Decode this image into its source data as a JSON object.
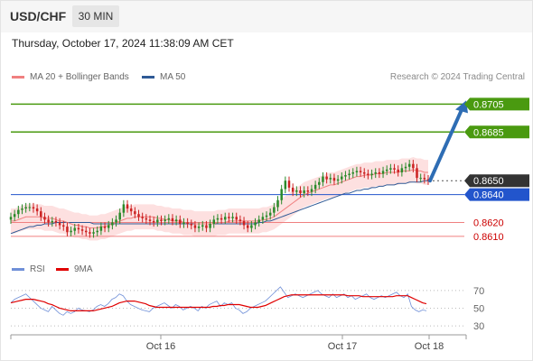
{
  "header": {
    "symbol": "USD/CHF",
    "timeframe": "30 MIN",
    "datetime": "Thursday, October 17, 2024 11:38:09 AM CET"
  },
  "legend": {
    "ma20_label": "MA 20 + Bollinger Bands",
    "ma50_label": "MA 50",
    "ma20_color": "#f08080",
    "ma50_color": "#2f5a96",
    "credit": "Research © 2024 Trading Central"
  },
  "rsi_legend": {
    "rsi_label": "RSI",
    "ma_label": "9MA",
    "rsi_color": "#7090d8",
    "ma_color": "#e00000"
  },
  "colors": {
    "up_candle": "#2a8a2a",
    "down_candle": "#cc2222",
    "target_line": "#4a9a10",
    "current_label": "#333333",
    "pivot_line": "#2255cc",
    "support_line": "#f08080",
    "support_text": "#cc0000",
    "arrow": "#2e6db4",
    "band_fill": "#fde0e0"
  },
  "chart_data": [
    {
      "type": "candlestick",
      "title": "USD/CHF 30 MIN",
      "ylim": [
        0.8595,
        0.8715
      ],
      "x_ticks": [
        "Oct 16",
        "Oct 17",
        "Oct 18"
      ],
      "levels": [
        {
          "value": 0.8705,
          "label": "0.8705",
          "kind": "target"
        },
        {
          "value": 0.8685,
          "label": "0.8685",
          "kind": "target"
        },
        {
          "value": 0.865,
          "label": "0.8650",
          "kind": "current"
        },
        {
          "value": 0.864,
          "label": "0.8640",
          "kind": "pivot"
        },
        {
          "value": 0.862,
          "label": "0.8620",
          "kind": "support"
        },
        {
          "value": 0.861,
          "label": "0.8610",
          "kind": "support"
        }
      ],
      "arrow": {
        "from": 0.865,
        "to": 0.8705
      },
      "close": [
        0.8624,
        0.8626,
        0.8629,
        0.863,
        0.8631,
        0.8631,
        0.863,
        0.8628,
        0.8624,
        0.8622,
        0.862,
        0.8621,
        0.862,
        0.8618,
        0.8617,
        0.8613,
        0.8614,
        0.8616,
        0.8615,
        0.8614,
        0.8613,
        0.8612,
        0.8613,
        0.8614,
        0.8617,
        0.8616,
        0.8618,
        0.862,
        0.8622,
        0.8627,
        0.8633,
        0.863,
        0.8628,
        0.8626,
        0.8624,
        0.8623,
        0.8622,
        0.8621,
        0.862,
        0.8622,
        0.8621,
        0.8622,
        0.8623,
        0.8621,
        0.8622,
        0.8619,
        0.862,
        0.8619,
        0.8618,
        0.8616,
        0.8617,
        0.8618,
        0.8616,
        0.8619,
        0.8622,
        0.8623,
        0.8622,
        0.8624,
        0.8623,
        0.8624,
        0.8622,
        0.8621,
        0.8618,
        0.8616,
        0.8618,
        0.862,
        0.8622,
        0.8624,
        0.8625,
        0.8627,
        0.8631,
        0.8636,
        0.8644,
        0.865,
        0.8645,
        0.8642,
        0.8643,
        0.8641,
        0.8643,
        0.8642,
        0.8644,
        0.8647,
        0.8649,
        0.8653,
        0.8651,
        0.8652,
        0.865,
        0.8651,
        0.8653,
        0.8654,
        0.8655,
        0.8656,
        0.8657,
        0.8656,
        0.8655,
        0.8654,
        0.8655,
        0.8656,
        0.8655,
        0.8657,
        0.8658,
        0.8659,
        0.8658,
        0.8656,
        0.8659,
        0.866,
        0.8662,
        0.8659,
        0.8652,
        0.8652,
        0.8651,
        0.865
      ],
      "ma20": [
        0.8621,
        0.8621,
        0.8622,
        0.8623,
        0.8624,
        0.8624,
        0.8624,
        0.8624,
        0.8624,
        0.8623,
        0.8623,
        0.8623,
        0.8622,
        0.8621,
        0.8621,
        0.862,
        0.8619,
        0.8618,
        0.8618,
        0.8617,
        0.8617,
        0.8616,
        0.8616,
        0.8616,
        0.8617,
        0.8617,
        0.8618,
        0.8619,
        0.862,
        0.8621,
        0.8622,
        0.8623,
        0.8623,
        0.8624,
        0.8624,
        0.8624,
        0.8624,
        0.8624,
        0.8624,
        0.8623,
        0.8623,
        0.8622,
        0.8622,
        0.8621,
        0.8621,
        0.8621,
        0.862,
        0.862,
        0.862,
        0.8619,
        0.8619,
        0.8619,
        0.8619,
        0.8619,
        0.8619,
        0.862,
        0.862,
        0.862,
        0.8621,
        0.8621,
        0.8621,
        0.8621,
        0.8621,
        0.8621,
        0.8621,
        0.8621,
        0.8621,
        0.8622,
        0.8622,
        0.8623,
        0.8624,
        0.8626,
        0.8628,
        0.863,
        0.8632,
        0.8634,
        0.8636,
        0.8638,
        0.864,
        0.8641,
        0.8642,
        0.8643,
        0.8644,
        0.8645,
        0.8646,
        0.8647,
        0.8647,
        0.8648,
        0.8649,
        0.865,
        0.8651,
        0.8652,
        0.8653,
        0.8653,
        0.8654,
        0.8654,
        0.8654,
        0.8655,
        0.8655,
        0.8655,
        0.8656,
        0.8656,
        0.8656,
        0.8656,
        0.8657,
        0.8657,
        0.8657,
        0.8658,
        0.8657,
        0.8657,
        0.8656,
        0.8656
      ],
      "ma50": [
        0.8612,
        0.8613,
        0.8614,
        0.8615,
        0.8616,
        0.8617,
        0.8617,
        0.8618,
        0.8618,
        0.8619,
        0.8619,
        0.8619,
        0.862,
        0.862,
        0.862,
        0.862,
        0.862,
        0.862,
        0.862,
        0.862,
        0.862,
        0.862,
        0.8619,
        0.8619,
        0.8619,
        0.8619,
        0.8619,
        0.8619,
        0.8619,
        0.8619,
        0.8619,
        0.8619,
        0.8619,
        0.8619,
        0.8619,
        0.8619,
        0.8619,
        0.8619,
        0.8619,
        0.8619,
        0.8619,
        0.8619,
        0.8619,
        0.8619,
        0.8619,
        0.8619,
        0.8619,
        0.8619,
        0.8619,
        0.8619,
        0.8619,
        0.8619,
        0.8619,
        0.8619,
        0.8619,
        0.8619,
        0.8619,
        0.8619,
        0.8619,
        0.8619,
        0.8619,
        0.8619,
        0.8619,
        0.8619,
        0.8619,
        0.8619,
        0.862,
        0.862,
        0.8621,
        0.8621,
        0.8622,
        0.8623,
        0.8624,
        0.8625,
        0.8626,
        0.8627,
        0.8628,
        0.8629,
        0.863,
        0.8631,
        0.8632,
        0.8633,
        0.8634,
        0.8635,
        0.8636,
        0.8637,
        0.8638,
        0.8639,
        0.864,
        0.8641,
        0.8641,
        0.8642,
        0.8643,
        0.8643,
        0.8644,
        0.8644,
        0.8645,
        0.8645,
        0.8646,
        0.8646,
        0.8647,
        0.8647,
        0.8647,
        0.8648,
        0.8648,
        0.8648,
        0.8649,
        0.8649,
        0.8649,
        0.8649,
        0.865,
        0.865
      ],
      "bb_width": 0.0009
    },
    {
      "type": "line",
      "title": "RSI",
      "ylim": [
        25,
        80
      ],
      "y_ticks": [
        70,
        50,
        30
      ],
      "series": [
        {
          "name": "RSI",
          "values": [
            56,
            60,
            62,
            64,
            66,
            62,
            58,
            54,
            50,
            48,
            46,
            52,
            48,
            44,
            42,
            46,
            44,
            46,
            50,
            48,
            47,
            46,
            48,
            52,
            54,
            52,
            55,
            60,
            62,
            66,
            64,
            58,
            54,
            52,
            50,
            48,
            47,
            46,
            50,
            52,
            54,
            56,
            53,
            50,
            54,
            52,
            48,
            50,
            52,
            50,
            47,
            52,
            50,
            54,
            56,
            58,
            52,
            56,
            54,
            56,
            50,
            48,
            44,
            46,
            50,
            52,
            54,
            56,
            58,
            62,
            66,
            70,
            74,
            68,
            62,
            64,
            66,
            64,
            62,
            64,
            66,
            68,
            70,
            66,
            64,
            62,
            66,
            62,
            64,
            66,
            62,
            64,
            60,
            62,
            64,
            66,
            62,
            60,
            62,
            64,
            62,
            64,
            66,
            68,
            64,
            62,
            66,
            52,
            48,
            46,
            48,
            47
          ]
        },
        {
          "name": "9MA",
          "values": [
            56,
            57,
            58,
            59,
            60,
            60,
            60,
            59,
            58,
            57,
            55,
            54,
            52,
            50,
            49,
            48,
            47,
            47,
            47,
            47,
            47,
            47,
            47,
            48,
            49,
            50,
            51,
            52,
            54,
            56,
            57,
            58,
            58,
            58,
            57,
            56,
            55,
            53,
            52,
            51,
            51,
            51,
            51,
            51,
            51,
            51,
            51,
            51,
            51,
            51,
            51,
            51,
            51,
            51,
            52,
            52,
            53,
            53,
            54,
            54,
            54,
            54,
            53,
            52,
            51,
            51,
            51,
            52,
            53,
            55,
            57,
            59,
            61,
            63,
            64,
            65,
            65,
            65,
            65,
            65,
            65,
            65,
            65,
            65,
            65,
            65,
            65,
            65,
            65,
            65,
            64,
            64,
            64,
            64,
            63,
            63,
            63,
            63,
            63,
            63,
            63,
            63,
            63,
            64,
            64,
            64,
            64,
            62,
            60,
            58,
            56,
            55
          ]
        }
      ]
    }
  ]
}
